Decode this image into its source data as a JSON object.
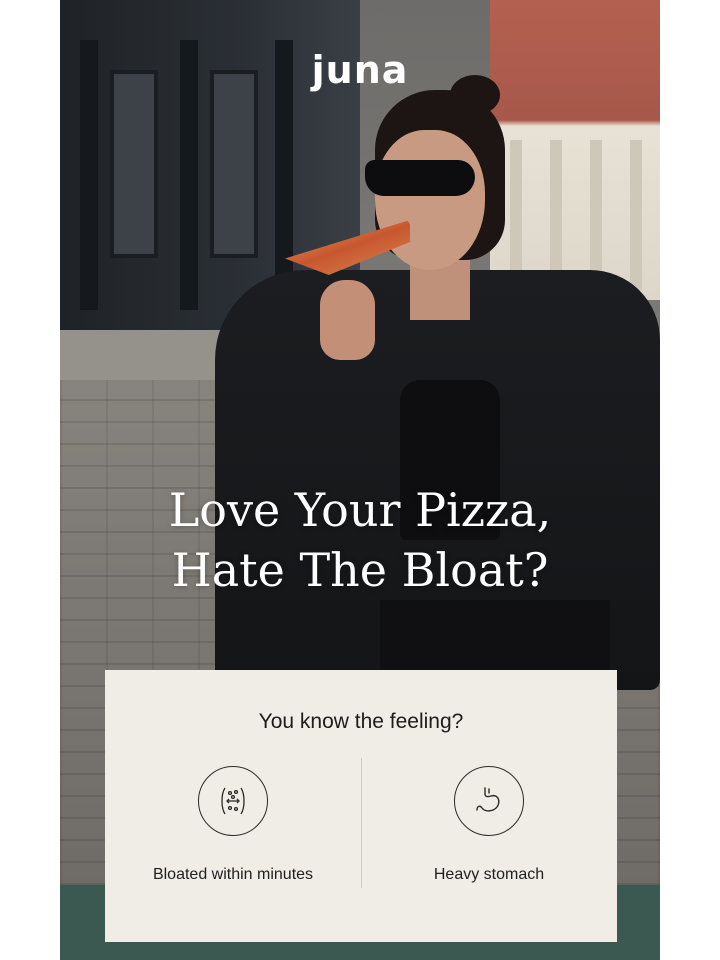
{
  "brand": {
    "logo_text": "juna"
  },
  "hero": {
    "headline_line1": "Love Your Pizza,",
    "headline_line2": "Hate The Bloat?"
  },
  "card": {
    "title": "You know the feeling?",
    "features": [
      {
        "label": "Bloated within minutes",
        "icon": "bloating-icon"
      },
      {
        "label": "Heavy stomach",
        "icon": "stomach-icon"
      }
    ]
  },
  "colors": {
    "band": "#3b5951",
    "card_background": "#efede6",
    "headline_text": "#ffffff"
  }
}
